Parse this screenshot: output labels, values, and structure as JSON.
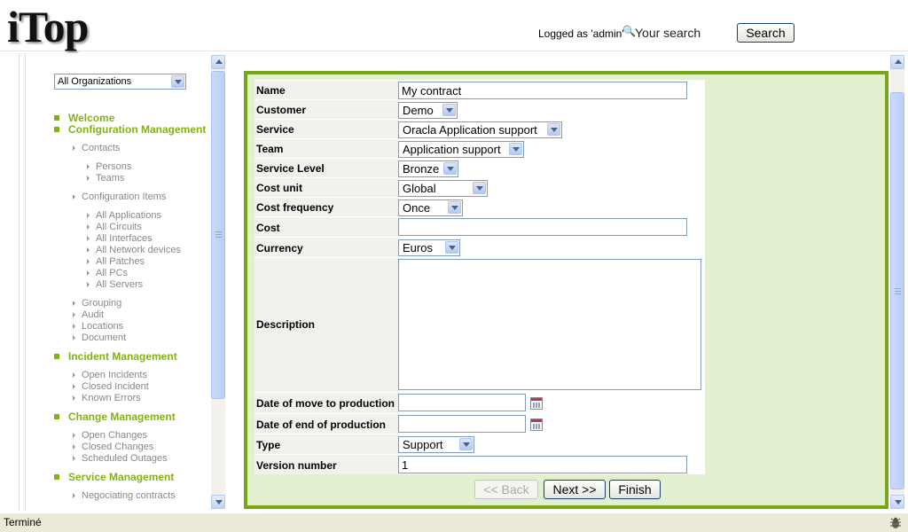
{
  "header": {
    "logo_text": "iTop",
    "logged_as": "Logged as 'admin'",
    "search_placeholder": "Your search",
    "search_button": "Search"
  },
  "sidebar": {
    "org_select_value": "All Organizations",
    "welcome": "Welcome",
    "config_management": "Configuration Management",
    "contacts": "Contacts",
    "contacts_items": [
      "Persons",
      "Teams"
    ],
    "configuration_items": "Configuration Items",
    "ci_items": [
      "All Applications",
      "All Circuits",
      "All Interfaces",
      "All Network devices",
      "All Patches",
      "All PCs",
      "All Servers"
    ],
    "config_other": [
      "Grouping",
      "Audit",
      "Locations",
      "Document"
    ],
    "incident_management": "Incident Management",
    "incident_items": [
      "Open Incidents",
      "Closed Incident",
      "Known Errors"
    ],
    "change_management": "Change Management",
    "change_items": [
      "Open Changes",
      "Closed Changes",
      "Scheduled Outages"
    ],
    "service_management": "Service Management",
    "service_items": [
      "Negociating contracts"
    ]
  },
  "form": {
    "name_label": "Name",
    "name_value": "My contract",
    "customer_label": "Customer",
    "customer_value": "Demo",
    "service_label": "Service",
    "service_value": "Oracla Application support",
    "team_label": "Team",
    "team_value": "Application support",
    "service_level_label": "Service Level",
    "service_level_value": "Bronze",
    "cost_unit_label": "Cost unit",
    "cost_unit_value": "Global",
    "cost_frequency_label": "Cost frequency",
    "cost_frequency_value": "Once",
    "cost_label": "Cost",
    "cost_value": "",
    "currency_label": "Currency",
    "currency_value": "Euros",
    "description_label": "Description",
    "description_value": "",
    "move_to_production_label": "Date of move to production",
    "move_to_production_value": "",
    "end_of_production_label": "Date of end of production",
    "end_of_production_value": "",
    "type_label": "Type",
    "type_value": "Support",
    "version_label": "Version number",
    "version_value": "1",
    "back_button": "<< Back",
    "next_button": "Next >>",
    "finish_button": "Finish"
  },
  "statusbar": {
    "text": "Terminé"
  },
  "colors": {
    "accent_green": "#78a619",
    "menu_green": "#83b217",
    "frame_bg": "#e2f0d0"
  }
}
